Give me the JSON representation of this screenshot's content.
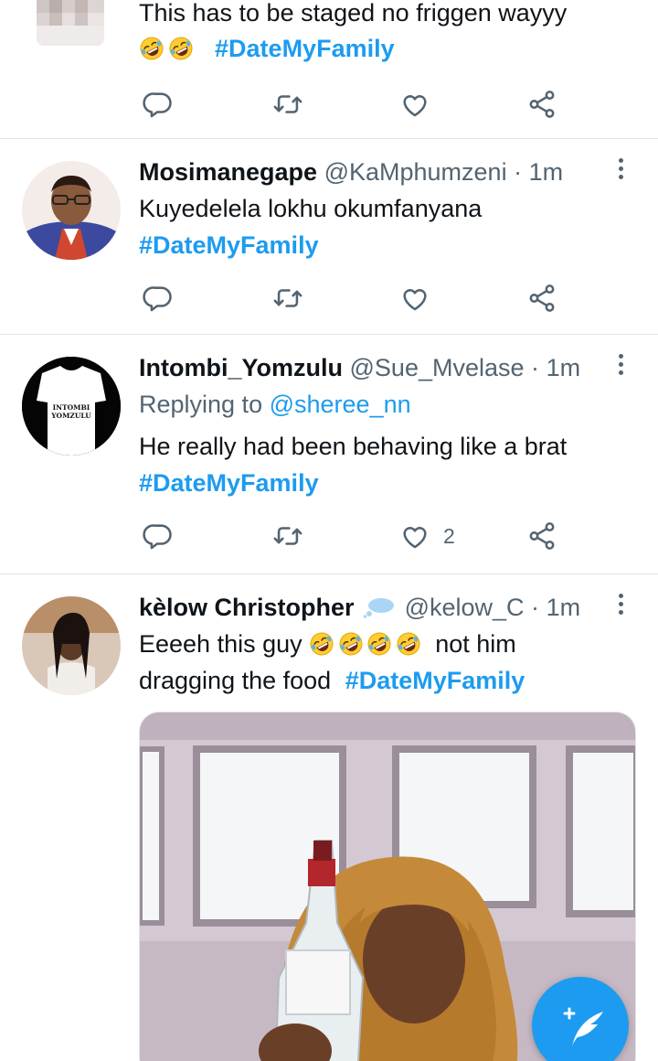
{
  "tweets": [
    {
      "text_line1": "This has to be staged no friggen wayyy",
      "hashtag": "#DateMyFamily",
      "emoji": [
        "rolling-on-floor-laughing",
        "rolling-on-floor-laughing"
      ]
    },
    {
      "name": "Mosimanegape",
      "handle": "@KaMphumzeni",
      "dot": "·",
      "time": "1m",
      "text_line1": "Kuyedelela lokhu okumfanyana",
      "hashtag": "#DateMyFamily"
    },
    {
      "name": "Intombi_Yomzulu",
      "handle": "@Sue_Mvelase",
      "dot": "·",
      "time": "1m",
      "reply_prefix": "Replying to",
      "reply_mention": "@sheree_nn",
      "text_line1": "He really had been behaving like a brat",
      "hashtag": "#DateMyFamily",
      "likes": "2",
      "avatar_text_line1": "INTOMBI",
      "avatar_text_line2": "YOMZULU"
    },
    {
      "name": "kèlow Christopher",
      "handle": "@kelow_C",
      "dot": "·",
      "time": "1m",
      "text_line1_pre": "Eeeeh this guy",
      "text_line1_post": "not him",
      "text_line2": "dragging the food",
      "hashtag": "#DateMyFamily",
      "emoji": [
        "rolling-on-floor-laughing",
        "rolling-on-floor-laughing",
        "rolling-on-floor-laughing",
        "rolling-on-floor-laughing"
      ],
      "name_badge": "thought-balloon-icon"
    }
  ],
  "icons": {
    "reply": "reply-icon",
    "retweet": "retweet-icon",
    "like": "heart-icon",
    "share": "share-icon",
    "compose": "compose-tweet-icon"
  },
  "colors": {
    "accent": "#1d9bf0",
    "text": "#0f1419",
    "muted": "#536471",
    "divider": "#dfe3e6"
  }
}
